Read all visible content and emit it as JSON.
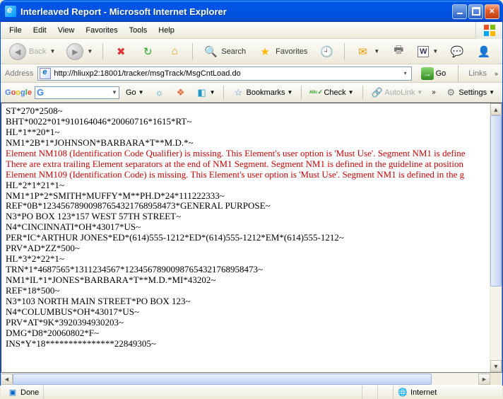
{
  "window": {
    "title": "Interleaved Report - Microsoft Internet Explorer"
  },
  "menu": {
    "file": "File",
    "edit": "Edit",
    "view": "View",
    "favorites": "Favorites",
    "tools": "Tools",
    "help": "Help"
  },
  "toolbar": {
    "back": "Back",
    "search": "Search",
    "favorites": "Favorites"
  },
  "address": {
    "label": "Address",
    "url": "http://hliuxp2:18001/tracker/msgTrack/MsgCntLoad.do",
    "go": "Go",
    "links": "Links"
  },
  "google": {
    "brand": "Google",
    "go": "Go",
    "bookmarks": "Bookmarks",
    "check": "Check",
    "autolink": "AutoLink",
    "settings": "Settings"
  },
  "content": {
    "lines": [
      {
        "t": "ST*270*2508~",
        "err": false
      },
      {
        "t": "BHT*0022*01*910164046*20060716*1615*RT~",
        "err": false
      },
      {
        "t": "HL*1**20*1~",
        "err": false
      },
      {
        "t": "NM1*2B*1*JOHNSON*BARBARA*T**M.D.*~",
        "err": false
      },
      {
        "t": "Element NM108 (Identification Code Qualifier) is missing. This Element's user option is 'Must Use'. Segment NM1 is define",
        "err": true
      },
      {
        "t": "There are extra trailing Element separators at the end of NM1 Segment. Segment NM1 is defined in the guideline at position",
        "err": true
      },
      {
        "t": "Element NM109 (Identification Code) is missing. This Element's user option is 'Must Use'. Segment NM1 is defined in the g",
        "err": true
      },
      {
        "t": "HL*2*1*21*1~",
        "err": false
      },
      {
        "t": "NM1*1P*2*SMITH*MUFFY*M**PH.D*24*111222333~",
        "err": false
      },
      {
        "t": "REF*0B*12345678900987654321768958473*GENERAL PURPOSE~",
        "err": false
      },
      {
        "t": "N3*PO BOX 123*157 WEST 57TH STREET~",
        "err": false
      },
      {
        "t": "N4*CINCINNATI*OH*43017*US~",
        "err": false
      },
      {
        "t": "PER*IC*ARTHUR JONES*ED*(614)555-1212*ED*(614)555-1212*EM*(614)555-1212~",
        "err": false
      },
      {
        "t": "PRV*AD*ZZ*500~",
        "err": false
      },
      {
        "t": "HL*3*2*22*1~",
        "err": false
      },
      {
        "t": "TRN*1*4687565*1311234567*12345678900987654321768958473~",
        "err": false
      },
      {
        "t": "NM1*IL*1*JONES*BARBARA*T**M.D.*MI*43202~",
        "err": false
      },
      {
        "t": "REF*18*500~",
        "err": false
      },
      {
        "t": "N3*103 NORTH MAIN STREET*PO BOX 123~",
        "err": false
      },
      {
        "t": "N4*COLUMBUS*OH*43017*US~",
        "err": false
      },
      {
        "t": "PRV*AT*9K*3920394930203~",
        "err": false
      },
      {
        "t": "DMG*D8*20060802*F~",
        "err": false
      },
      {
        "t": "INS*Y*18***************22849305~",
        "err": false
      }
    ]
  },
  "status": {
    "done": "Done",
    "zone": "Internet"
  }
}
